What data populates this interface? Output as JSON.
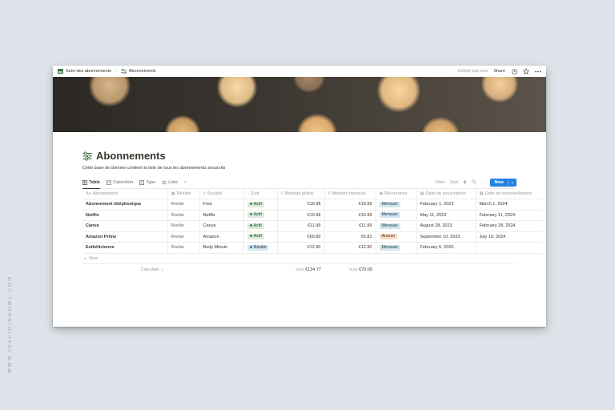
{
  "watermark": "WWW.INSPIRINGOWL.COM",
  "topbar": {
    "breadcrumb_parent": "Suivi des abonnements",
    "breadcrumb_sep": "/",
    "breadcrumb_current": "Abonnements",
    "edited": "Edited just now",
    "share": "Share"
  },
  "page": {
    "title": "Abonnements",
    "description": "Cette base de donnée contient la liste de tous les abonnements souscrits"
  },
  "views": {
    "tabs": [
      "Table",
      "Calendrier",
      "Type",
      "Liste"
    ],
    "add": "+",
    "filter": "Filter",
    "sort": "Sort",
    "more": "···",
    "new_label": "New",
    "new_dropdown": "⌄"
  },
  "table": {
    "columns": [
      "Abonnement",
      "Résilier",
      "Société",
      "Etat",
      "Montant global",
      "Montant mensuel",
      "Récurrence",
      "Date de souscription",
      "Date de renouvellement"
    ],
    "rows": [
      {
        "abonnement": "Abonnement téléphonique",
        "resilier": "Résilier",
        "societe": "Free",
        "etat": "Actif",
        "global": "€19.99",
        "mensuel": "€19.99",
        "recurrence": "Mensuel",
        "souscription": "February 1, 2023",
        "renouvellement": "March 1, 2024"
      },
      {
        "abonnement": "Netflix",
        "resilier": "Résilier",
        "societe": "Netflix",
        "etat": "Actif",
        "global": "€19.99",
        "mensuel": "€19.99",
        "recurrence": "Mensuel",
        "souscription": "May 11, 2023",
        "renouvellement": "February 11, 2024"
      },
      {
        "abonnement": "Canva",
        "resilier": "Résilier",
        "societe": "Canva",
        "etat": "Actif",
        "global": "€11.99",
        "mensuel": "€11.99",
        "recurrence": "Mensuel",
        "souscription": "August 28, 2023",
        "renouvellement": "February 28, 2024"
      },
      {
        "abonnement": "Amazon Prime",
        "resilier": "Résilier",
        "societe": "Amazon",
        "etat": "Actif",
        "global": "€69.90",
        "mensuel": "€5.82",
        "recurrence": "Annuel",
        "souscription": "September 10, 2023",
        "renouvellement": "July 10, 2024"
      },
      {
        "abonnement": "Esthéticienne",
        "resilier": "Résilier",
        "societe": "Body Minute",
        "etat": "Résilié",
        "global": "€12.90",
        "mensuel": "€12.90",
        "recurrence": "Mensuel",
        "souscription": "February 5, 2020",
        "renouvellement": ""
      }
    ],
    "new_row": "New",
    "footer": {
      "calculate": "Calculate ⌄",
      "sum_label": "SUM",
      "sum_global": "€134.77",
      "sum_mensuel": "€70.69"
    }
  },
  "colors": {
    "accent": "#2383e2",
    "pill_green": "#dbeddb",
    "pill_blue": "#d3e5ef",
    "pill_orange": "#fadec9"
  }
}
